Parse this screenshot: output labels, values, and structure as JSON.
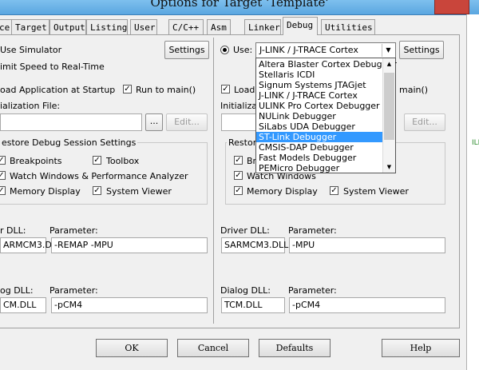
{
  "window": {
    "title": "Options for Target 'Template'"
  },
  "tabs": [
    {
      "label": "ce"
    },
    {
      "label": "Target"
    },
    {
      "label": "Output"
    },
    {
      "label": "Listing"
    },
    {
      "label": "User"
    },
    {
      "label": "C/C++"
    },
    {
      "label": "Asm"
    },
    {
      "label": "Linker"
    },
    {
      "label": "Debug",
      "active": true
    },
    {
      "label": "Utilities"
    }
  ],
  "left": {
    "use_simulator": "Use Simulator",
    "settings": "Settings",
    "limit_speed": "imit Speed to Real-Time",
    "load_app": "oad Application at Startup",
    "run_main": "Run to main()",
    "init_file_label": "ialization File:",
    "browse": "...",
    "edit": "Edit...",
    "restore_title": "estore Debug Session Settings",
    "breakpoints": "Breakpoints",
    "toolbox": "Toolbox",
    "watch": "Watch Windows & Performance Analyzer",
    "memory": "Memory Display",
    "system_viewer": "System Viewer",
    "driver_label": "r DLL:",
    "driver_value": "ARMCM3.DLL",
    "param_label": "Parameter:",
    "param_value": "-REMAP -MPU",
    "dialog_label": "og DLL:",
    "dialog_value": "CM.DLL",
    "dialog_param_label": "Parameter:",
    "dialog_param_value": "-pCM4"
  },
  "right": {
    "use": "Use:",
    "selected": "J-LINK / J-TRACE Cortex",
    "settings": "Settings",
    "load": "Load",
    "run_main": "main()",
    "init_label": "Initializatio",
    "edit": "Edit...",
    "restore": "Restore",
    "breakpoints": "Brea",
    "watch": "Watch Windows",
    "memory": "Memory Display",
    "system_viewer": "System Viewer",
    "driver_label": "Driver DLL:",
    "driver_value": "SARMCM3.DLL",
    "param_label": "Parameter:",
    "param_value": "-MPU",
    "dialog_label": "Dialog DLL:",
    "dialog_value": "TCM.DLL",
    "dialog_param_label": "Parameter:",
    "dialog_param_value": "-pCM4"
  },
  "dropdown_options": [
    "Altera Blaster Cortex Debugger",
    "Stellaris ICDI",
    "Signum Systems JTAGjet",
    "J-LINK / J-TRACE Cortex",
    "ULINK Pro Cortex Debugger",
    "NULink Debugger",
    "SiLabs UDA Debugger",
    "ST-Link Debugger",
    "CMSIS-DAP Debugger",
    "Fast Models Debugger",
    "PEMicro Debugger"
  ],
  "dropdown_selected_index": 7,
  "footer": {
    "ok": "OK",
    "cancel": "Cancel",
    "defaults": "Defaults",
    "help": "Help"
  },
  "edge_text": "ILI"
}
